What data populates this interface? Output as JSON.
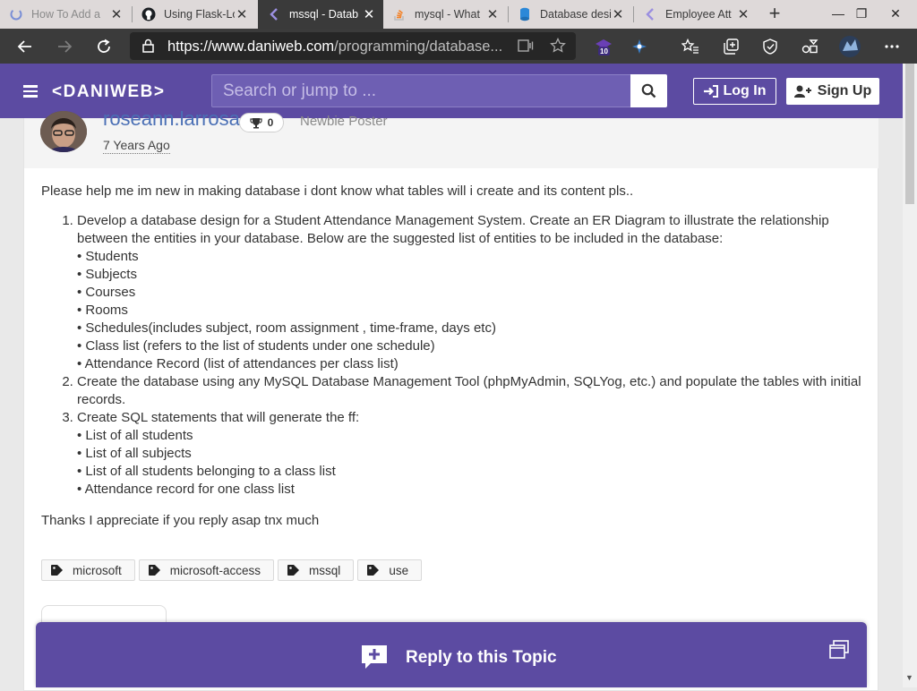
{
  "browser": {
    "tabs": [
      {
        "title": "How To Add a",
        "icon": "loading-icon",
        "active": false
      },
      {
        "title": "Using Flask-Lo",
        "icon": "github-icon",
        "active": false
      },
      {
        "title": "mssql - Datab",
        "icon": "daniweb-icon",
        "active": true
      },
      {
        "title": "mysql - What",
        "icon": "stackoverflow-icon",
        "active": false
      },
      {
        "title": "Database desi",
        "icon": "database-icon",
        "active": false
      },
      {
        "title": "Employee Att",
        "icon": "daniweb-icon",
        "active": false
      }
    ],
    "url_host": "https://www.daniweb.com",
    "url_path": "/programming/database...",
    "extension_badge": "10"
  },
  "site": {
    "logo": "<DANIWEB>",
    "search_placeholder": "Search or jump to ...",
    "login_label": "Log In",
    "signup_label": "Sign Up"
  },
  "post": {
    "author": "roseann.larrosa",
    "reputation": "0",
    "rank": "Newbie Poster",
    "time": "7 Years Ago",
    "intro": "Please help me im new in making database i dont know what tables will i create and its content pls..",
    "items": [
      {
        "text": "Develop a database design for a Student Attendance Management System. Create an ER Diagram to illustrate the relationship between the entities in your database. Below are the suggested list of entities to be included in the database:",
        "subitems": [
          "• Students",
          "• Subjects",
          "• Courses",
          "• Rooms",
          "• Schedules(includes subject, room assignment , time-frame, days etc)",
          "• Class list (refers to the list of students under one schedule)",
          "• Attendance Record (list of attendances per class list)"
        ]
      },
      {
        "text": "Create the database using any MySQL Database Management Tool (phpMyAdmin, SQLYog, etc.) and populate the tables with initial records.",
        "subitems": []
      },
      {
        "text": "Create SQL statements that will generate the ff:",
        "subitems": [
          "• List of all students",
          "• List of all subjects",
          "• List of all students belonging to a class list",
          "• Attendance record for one class list"
        ]
      }
    ],
    "closing": "Thanks I appreciate if you reply asap tnx much",
    "tags": [
      "microsoft",
      "microsoft-access",
      "mssql",
      "use"
    ]
  },
  "reply": {
    "label": "Reply to this Topic"
  },
  "colors": {
    "brand": "#5c4ba2",
    "link": "#4a6fb5"
  }
}
